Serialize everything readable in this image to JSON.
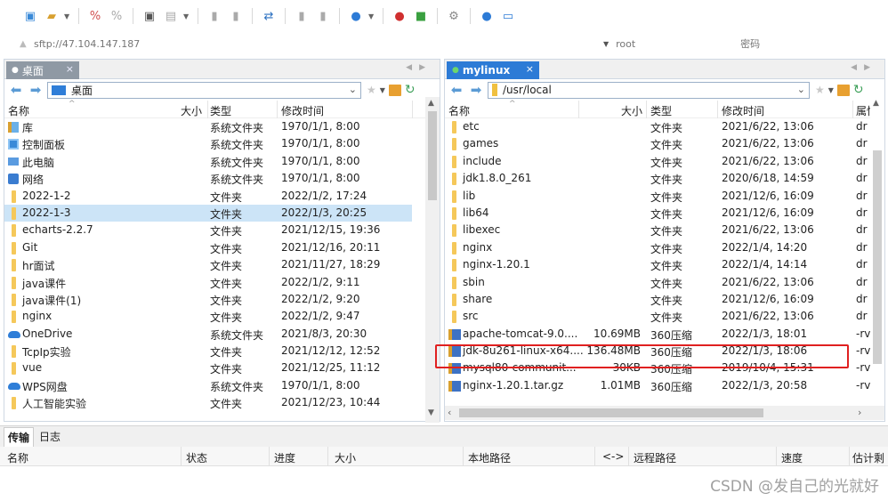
{
  "connection": {
    "host_placeholder": "sftp://47.104.147.187",
    "user_placeholder": "root",
    "password_placeholder": "密码"
  },
  "left_pane": {
    "tab_label": "桌面",
    "path": "桌面",
    "columns": {
      "name": "名称",
      "size": "大小",
      "type": "类型",
      "modified": "修改时间"
    },
    "files": [
      {
        "name": "库",
        "size": "",
        "type": "系统文件夹",
        "modified": "1970/1/1, 8:00",
        "icon": "library-icon"
      },
      {
        "name": "控制面板",
        "size": "",
        "type": "系统文件夹",
        "modified": "1970/1/1, 8:00",
        "icon": "control-panel-icon"
      },
      {
        "name": "此电脑",
        "size": "",
        "type": "系统文件夹",
        "modified": "1970/1/1, 8:00",
        "icon": "computer-icon"
      },
      {
        "name": "网络",
        "size": "",
        "type": "系统文件夹",
        "modified": "1970/1/1, 8:00",
        "icon": "network-icon"
      },
      {
        "name": "2022-1-2",
        "size": "",
        "type": "文件夹",
        "modified": "2022/1/2, 17:24",
        "icon": "folder-icon"
      },
      {
        "name": "2022-1-3",
        "size": "",
        "type": "文件夹",
        "modified": "2022/1/3, 20:25",
        "icon": "folder-icon",
        "selected": true
      },
      {
        "name": "echarts-2.2.7",
        "size": "",
        "type": "文件夹",
        "modified": "2021/12/15, 19:36",
        "icon": "folder-icon"
      },
      {
        "name": "Git",
        "size": "",
        "type": "文件夹",
        "modified": "2021/12/16, 20:11",
        "icon": "folder-icon"
      },
      {
        "name": "hr面试",
        "size": "",
        "type": "文件夹",
        "modified": "2021/11/27, 18:29",
        "icon": "folder-icon"
      },
      {
        "name": "java课件",
        "size": "",
        "type": "文件夹",
        "modified": "2022/1/2, 9:11",
        "icon": "folder-icon"
      },
      {
        "name": "java课件(1)",
        "size": "",
        "type": "文件夹",
        "modified": "2022/1/2, 9:20",
        "icon": "folder-icon"
      },
      {
        "name": "nginx",
        "size": "",
        "type": "文件夹",
        "modified": "2022/1/2, 9:47",
        "icon": "folder-icon"
      },
      {
        "name": "OneDrive",
        "size": "",
        "type": "系统文件夹",
        "modified": "2021/8/3, 20:30",
        "icon": "onedrive-icon"
      },
      {
        "name": "TcpIp实验",
        "size": "",
        "type": "文件夹",
        "modified": "2021/12/12, 12:52",
        "icon": "folder-icon"
      },
      {
        "name": "vue",
        "size": "",
        "type": "文件夹",
        "modified": "2021/12/25, 11:12",
        "icon": "folder-icon"
      },
      {
        "name": "WPS网盘",
        "size": "",
        "type": "系统文件夹",
        "modified": "1970/1/1, 8:00",
        "icon": "wps-cloud-icon"
      },
      {
        "name": "人工智能实验",
        "size": "",
        "type": "文件夹",
        "modified": "2021/12/23, 10:44",
        "icon": "folder-icon"
      }
    ]
  },
  "right_pane": {
    "tab_label": "mylinux",
    "path": "/usr/local",
    "columns": {
      "name": "名称",
      "size": "大小",
      "type": "类型",
      "modified": "修改时间",
      "perm": "属性"
    },
    "files": [
      {
        "name": "etc",
        "size": "",
        "type": "文件夹",
        "modified": "2021/6/22, 13:06",
        "perm": "dr",
        "icon": "folder-icon"
      },
      {
        "name": "games",
        "size": "",
        "type": "文件夹",
        "modified": "2021/6/22, 13:06",
        "perm": "dr",
        "icon": "folder-icon"
      },
      {
        "name": "include",
        "size": "",
        "type": "文件夹",
        "modified": "2021/6/22, 13:06",
        "perm": "dr",
        "icon": "folder-icon"
      },
      {
        "name": "jdk1.8.0_261",
        "size": "",
        "type": "文件夹",
        "modified": "2020/6/18, 14:59",
        "perm": "dr",
        "icon": "folder-icon"
      },
      {
        "name": "lib",
        "size": "",
        "type": "文件夹",
        "modified": "2021/12/6, 16:09",
        "perm": "dr",
        "icon": "folder-icon"
      },
      {
        "name": "lib64",
        "size": "",
        "type": "文件夹",
        "modified": "2021/12/6, 16:09",
        "perm": "dr",
        "icon": "folder-icon"
      },
      {
        "name": "libexec",
        "size": "",
        "type": "文件夹",
        "modified": "2021/6/22, 13:06",
        "perm": "dr",
        "icon": "folder-icon"
      },
      {
        "name": "nginx",
        "size": "",
        "type": "文件夹",
        "modified": "2022/1/4, 14:20",
        "perm": "dr",
        "icon": "folder-icon"
      },
      {
        "name": "nginx-1.20.1",
        "size": "",
        "type": "文件夹",
        "modified": "2022/1/4, 14:14",
        "perm": "dr",
        "icon": "folder-icon"
      },
      {
        "name": "sbin",
        "size": "",
        "type": "文件夹",
        "modified": "2021/6/22, 13:06",
        "perm": "dr",
        "icon": "folder-icon"
      },
      {
        "name": "share",
        "size": "",
        "type": "文件夹",
        "modified": "2021/12/6, 16:09",
        "perm": "dr",
        "icon": "folder-icon"
      },
      {
        "name": "src",
        "size": "",
        "type": "文件夹",
        "modified": "2021/6/22, 13:06",
        "perm": "dr",
        "icon": "folder-icon"
      },
      {
        "name": "apache-tomcat-9.0....",
        "size": "10.69MB",
        "type": "360压缩",
        "modified": "2022/1/3, 18:01",
        "perm": "-rv",
        "icon": "archive-icon"
      },
      {
        "name": "jdk-8u261-linux-x64....",
        "size": "136.48MB",
        "type": "360压缩",
        "modified": "2022/1/3, 18:06",
        "perm": "-rv",
        "icon": "archive-icon",
        "highlighted": true
      },
      {
        "name": "mysql80-communit...",
        "size": "30KB",
        "type": "360压缩",
        "modified": "2019/10/4, 15:31",
        "perm": "-rv",
        "icon": "archive-icon"
      },
      {
        "name": "nginx-1.20.1.tar.gz",
        "size": "1.01MB",
        "type": "360压缩",
        "modified": "2022/1/3, 20:58",
        "perm": "-rv",
        "icon": "archive-icon"
      }
    ]
  },
  "transfer": {
    "tabs": [
      "传输",
      "日志"
    ],
    "columns": [
      "名称",
      "状态",
      "进度",
      "大小",
      "本地路径",
      "<->",
      "远程路径",
      "速度",
      "估计剩"
    ]
  },
  "watermark": "CSDN @发自己的光就好",
  "colors": {
    "tab_active": "#2d7bd6",
    "tab_inactive": "#8f99a4",
    "selection": "#cce4f7",
    "highlight_box": "#e02020"
  }
}
